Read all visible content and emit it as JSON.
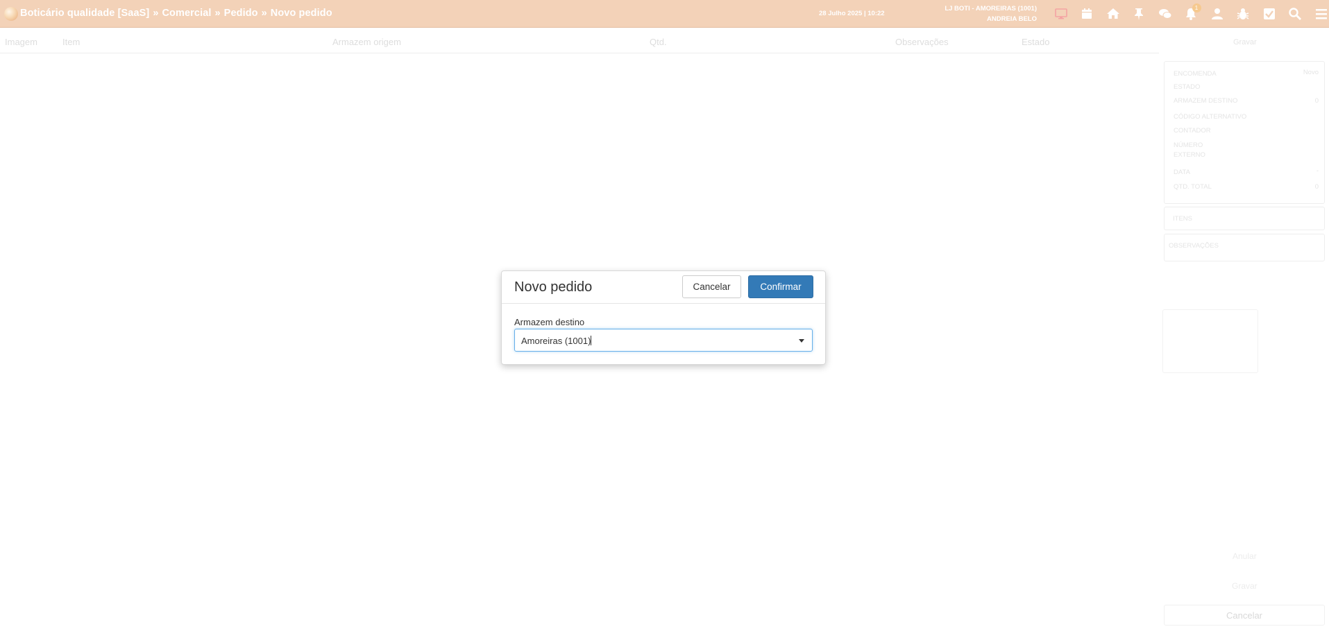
{
  "topbar": {
    "breadcrumb": [
      "Boticário qualidade [SaaS]",
      "Comercial",
      "Pedido",
      "Novo pedido"
    ],
    "separator": "»",
    "datetime": "28 Julho 2025 | 10:22",
    "store": "LJ BOTI - AMOREIRAS (1001)",
    "user": "ANDREIA BELO",
    "notification_count": "1",
    "icons": [
      "monitor-icon",
      "calendar-icon",
      "home-icon",
      "pin-icon",
      "chat-icon",
      "bell-icon",
      "user-icon",
      "bug-icon",
      "checkbox-icon",
      "search-icon",
      "menu-icon"
    ]
  },
  "table": {
    "columns": [
      "Imagem",
      "Item",
      "Armazem origem",
      "Qtd.",
      "Observações",
      "Estado"
    ]
  },
  "side_panel": {
    "top_label": "Gravar",
    "details": [
      {
        "label": "Encomenda",
        "value": "Novo"
      },
      {
        "label": "Estado",
        "value": ""
      },
      {
        "label": "Armazem destino",
        "value": "0"
      },
      {
        "label": "Código alternativo",
        "value": ""
      },
      {
        "label": "Contador",
        "value": ""
      },
      {
        "label": "Número externo",
        "value": ""
      },
      {
        "label": "Data",
        "value": "-"
      },
      {
        "label": "Qtd. total",
        "value": "0"
      }
    ],
    "sections": [
      "Itens",
      "Observações"
    ],
    "bottom_actions": [
      "Anular",
      "Gravar"
    ],
    "cancel_label": "Cancelar"
  },
  "modal": {
    "title": "Novo pedido",
    "cancel_label": "Cancelar",
    "confirm_label": "Confirmar",
    "field_label": "Armazem destino",
    "field_value": "Amoreiras (1001)"
  },
  "colors": {
    "topbar": "#f3d2b8",
    "primary": "#337ab7"
  }
}
